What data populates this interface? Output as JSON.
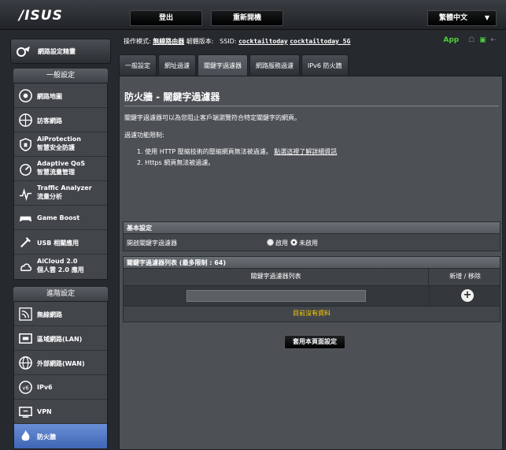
{
  "header": {
    "logo": "/ISUS",
    "logout": "登出",
    "reboot": "重新開機",
    "language": "繁體中文"
  },
  "sidebar": {
    "quick_setup": "網路設定精靈",
    "general_section": "一般設定",
    "general_items": [
      {
        "label": "網路地圖",
        "icon": "network-map-icon"
      },
      {
        "label": "訪客網路",
        "icon": "guest-network-icon"
      },
      {
        "label": "AiProtection",
        "label2": "智慧安全防護",
        "icon": "aiprotection-icon"
      },
      {
        "label": "Adaptive QoS",
        "label2": "智慧流量管理",
        "icon": "qos-icon"
      },
      {
        "label": "Traffic Analyzer",
        "label2": "流量分析",
        "icon": "traffic-analyzer-icon"
      },
      {
        "label": "Game Boost",
        "icon": "game-boost-icon"
      },
      {
        "label": "USB 相關應用",
        "icon": "usb-icon"
      },
      {
        "label": "AiCloud 2.0",
        "label2": "個人雲 2.0 應用",
        "icon": "aicloud-icon"
      }
    ],
    "advanced_section": "進階設定",
    "advanced_items": [
      {
        "label": "無線網路",
        "icon": "wireless-icon"
      },
      {
        "label": "區域網路(LAN)",
        "icon": "lan-icon"
      },
      {
        "label": "外部網路(WAN)",
        "icon": "wan-icon"
      },
      {
        "label": "IPv6",
        "icon": "ipv6-icon"
      },
      {
        "label": "VPN",
        "icon": "vpn-icon"
      },
      {
        "label": "防火牆",
        "icon": "firewall-icon"
      }
    ]
  },
  "status_bar": {
    "mode_label": "操作模式:",
    "mode_value": "無線路由器",
    "firmware_label": "韌體版本:",
    "ssid_label": "SSID:",
    "ssid1": "cocktailtoday",
    "ssid2": "cocktailtoday_5G",
    "app_label": "App"
  },
  "tabs": [
    "一般設定",
    "網址過濾",
    "關鍵字過濾器",
    "網路服務過濾",
    "IPv6 防火牆"
  ],
  "page": {
    "title": "防火牆 - 關鍵字過濾器",
    "description": "關鍵字過濾器可以為您阻止客戶端瀏覽符合特定關鍵字的網頁。",
    "limits_label": "過濾功能限制:",
    "limit1_prefix": "1. 使用 HTTP 壓縮技術的壓縮網頁無法被過濾。",
    "limit1_link": "點選這裡了解詳細資訊",
    "limit2": "2. Https 網頁無法被過濾。",
    "basic_settings": "基本設定",
    "enable_label": "開啟關鍵字過濾器",
    "radio_on": "啟用",
    "radio_off": "未啟用",
    "list_title": "關鍵字過濾器列表 (最多限制 : 64)",
    "col_list": "關鍵字過濾器列表",
    "col_action": "新增 / 移除",
    "empty": "目前沒有資料",
    "apply": "套用本頁面設定"
  }
}
